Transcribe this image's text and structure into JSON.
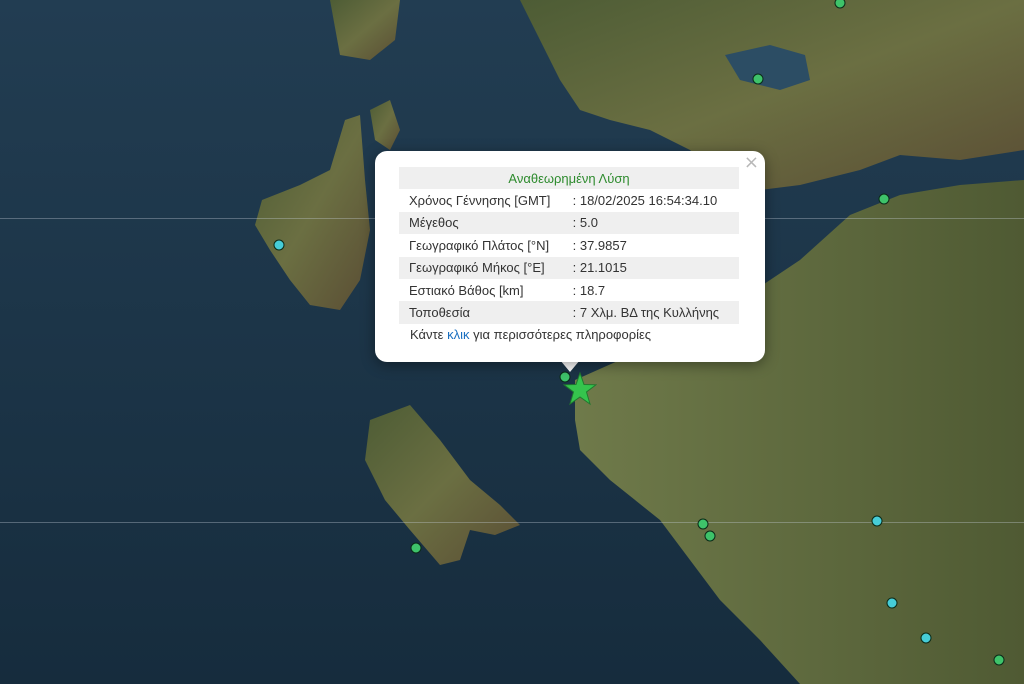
{
  "popup": {
    "title": "Αναθεωρημένη Λύση",
    "close_symbol": "×",
    "rows": [
      {
        "label": "Χρόνος Γέννησης [GMT]",
        "value": ": 18/02/2025 16:54:34.10"
      },
      {
        "label": "Μέγεθος",
        "value": ": 5.0"
      },
      {
        "label": "Γεωγραφικό Πλάτος [°N]",
        "value": ": 37.9857"
      },
      {
        "label": "Γεωγραφικό Μήκος [°E]",
        "value": ": 21.1015"
      },
      {
        "label": "Εστιακό Βάθος [km]",
        "value": ": 18.7"
      },
      {
        "label": "Τοποθεσία",
        "value": ": 7 Χλμ. ΒΔ της Κυλλήνης"
      }
    ],
    "footer_prefix": "Κάντε ",
    "footer_link": "κλικ",
    "footer_suffix": " για περισσότερες πληροφορίες"
  },
  "map": {
    "epicenter_icon": "star-icon",
    "station_icon": "circle-icon",
    "colors": {
      "sea": "#1a3346",
      "land": "#5a6a3a",
      "epicenter": "#35c44d",
      "station_green": "#3ec36a",
      "station_cyan": "#46cdd8",
      "popup_title": "#2e8b2e",
      "link": "#1a6fc0"
    }
  }
}
